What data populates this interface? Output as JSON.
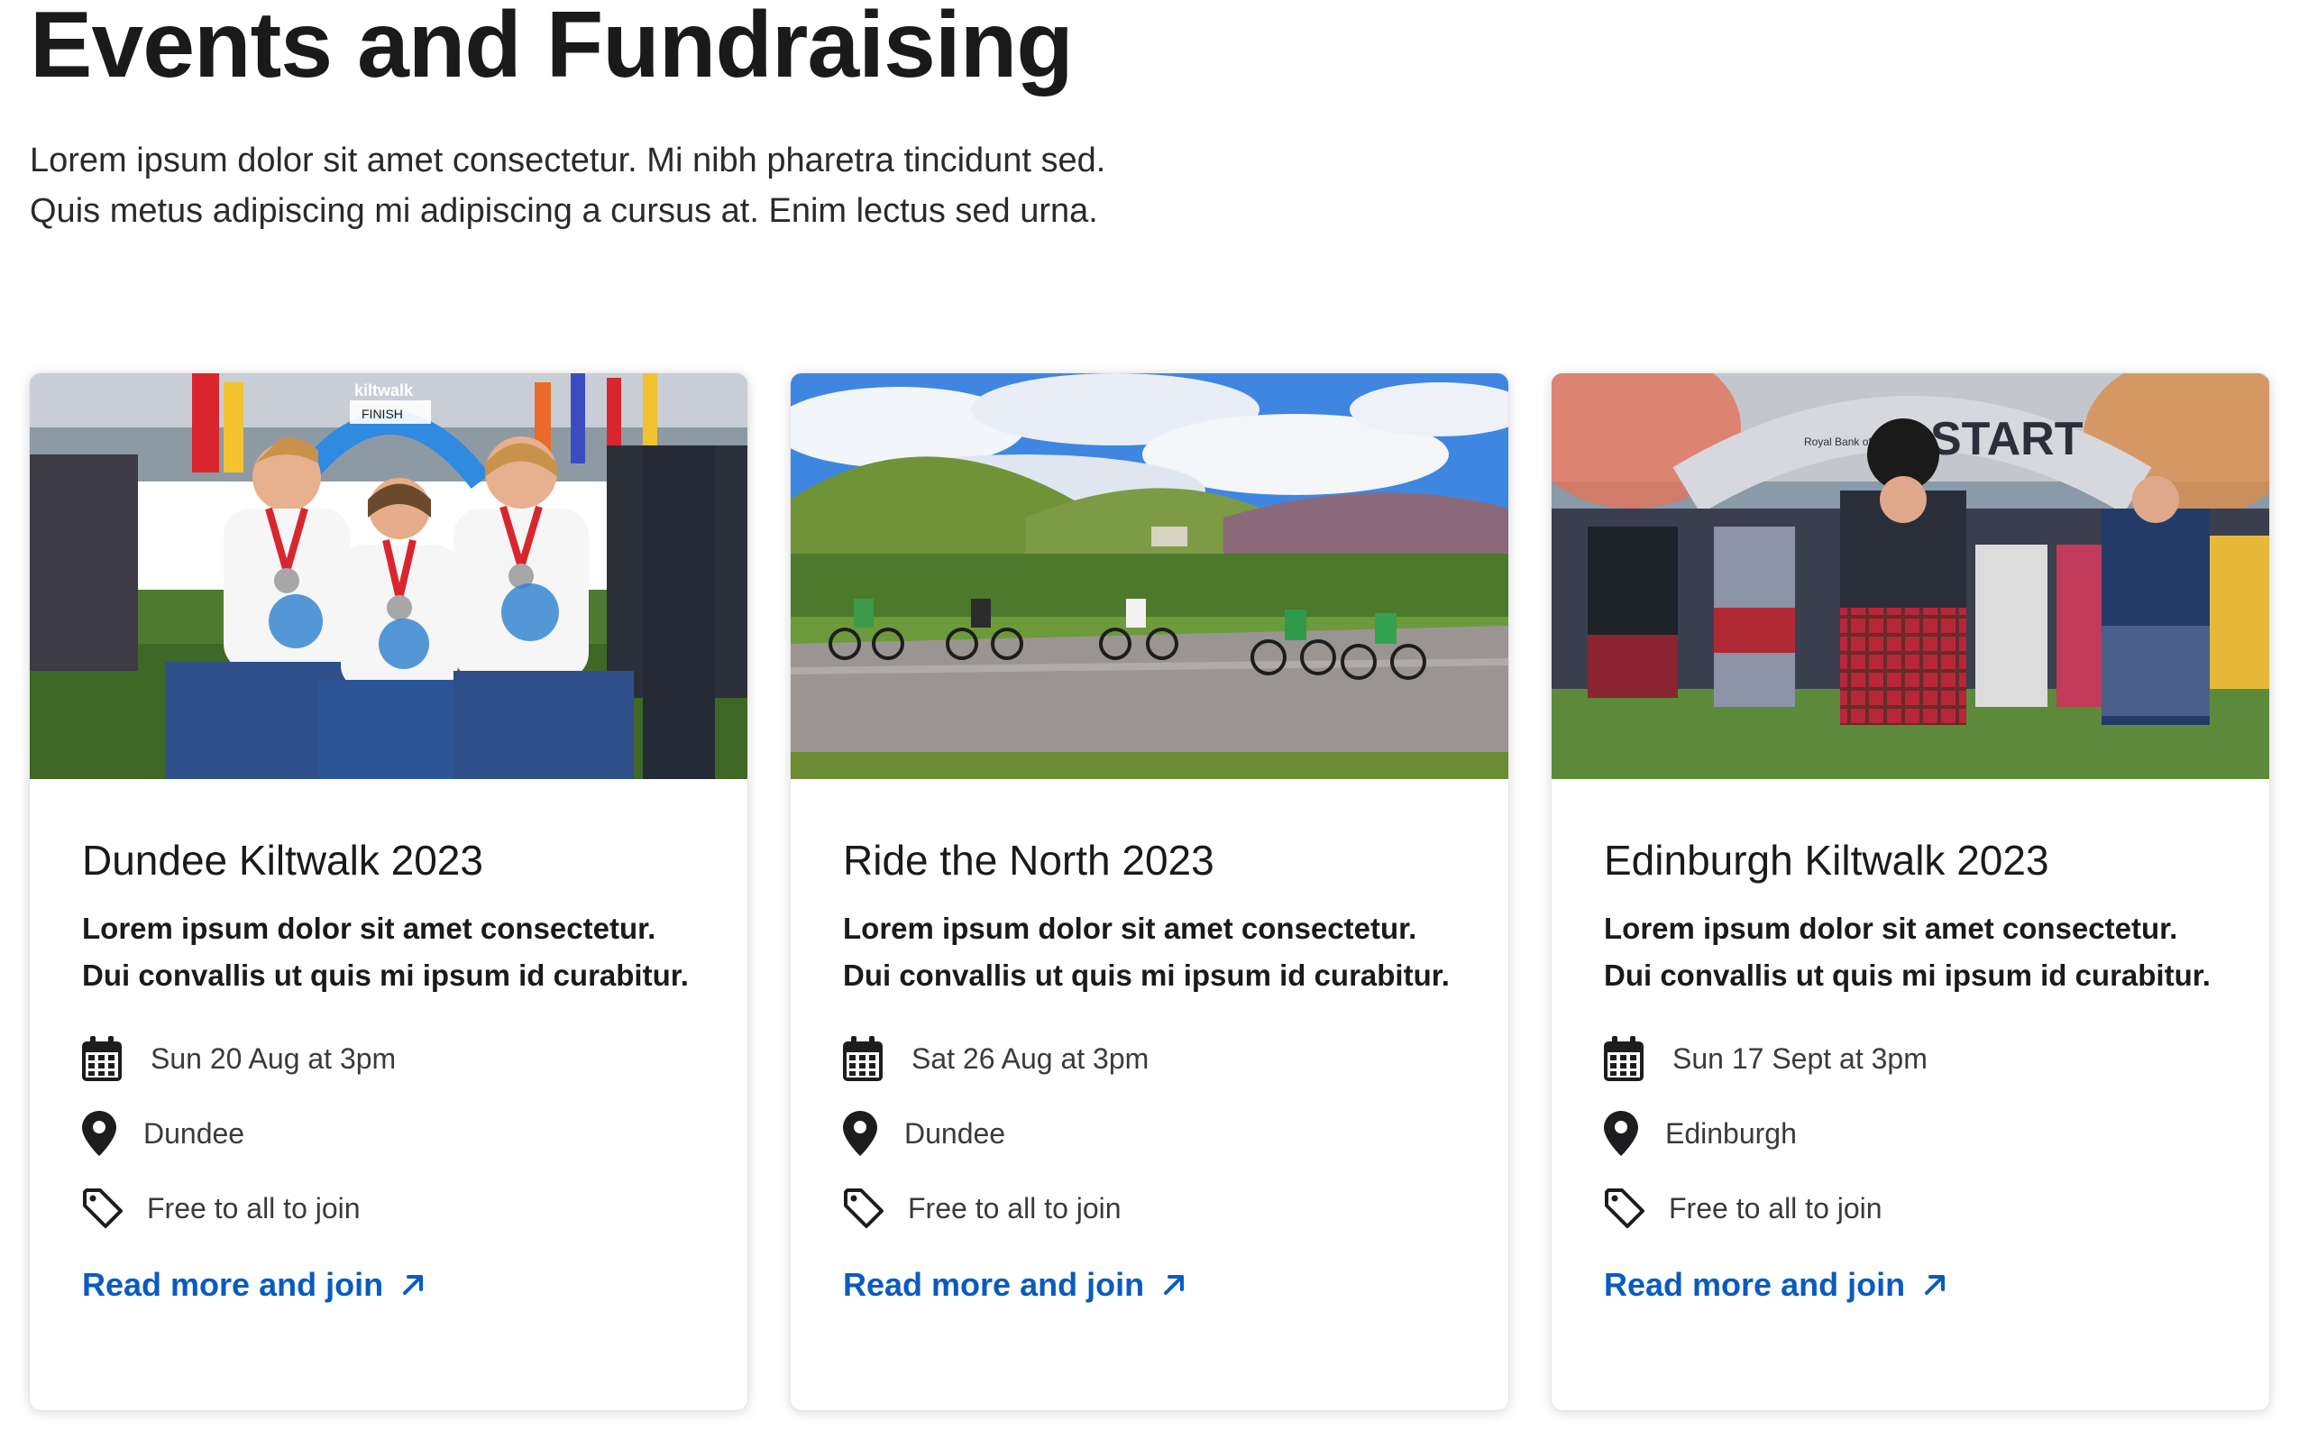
{
  "header": {
    "title": "Events and Fundraising",
    "intro_line_1": "Lorem ipsum dolor sit amet consectetur. Mi nibh pharetra tincidunt sed.",
    "intro_line_2": "Quis metus adipiscing mi adipiscing a cursus at. Enim lectus sed urna."
  },
  "colors": {
    "link": "#0a5bbf",
    "text": "#1a1a1a"
  },
  "cards": [
    {
      "title": "Dundee Kiltwalk 2023",
      "desc_line_1": "Lorem ipsum dolor sit amet consectetur.",
      "desc_line_2": "Dui convallis ut quis mi ipsum id curabitur.",
      "date": "Sun 20 Aug at 3pm",
      "location": "Dundee",
      "price": "Free to all to join",
      "link_label": "Read more and join",
      "image_icon": "kiltwalk-walkers-photo",
      "image_text": [
        "kiltwalk",
        "FINISH"
      ]
    },
    {
      "title": "Ride the North 2023",
      "desc_line_1": "Lorem ipsum dolor sit amet consectetur.",
      "desc_line_2": "Dui convallis ut quis mi ipsum id curabitur.",
      "date": "Sat 26 Aug at 3pm",
      "location": "Dundee",
      "price": "Free to all to join",
      "link_label": "Read more and join",
      "image_icon": "cyclists-highlands-photo"
    },
    {
      "title": "Edinburgh Kiltwalk 2023",
      "desc_line_1": "Lorem ipsum dolor sit amet consectetur.",
      "desc_line_2": "Dui convallis ut quis mi ipsum id curabitur.",
      "date": "Sun 17 Sept at 3pm",
      "location": "Edinburgh",
      "price": "Free to all to join",
      "link_label": "Read more and join",
      "image_icon": "bagpiper-start-line-photo",
      "image_text": [
        "START",
        "Royal Bank of Scotland"
      ]
    }
  ]
}
